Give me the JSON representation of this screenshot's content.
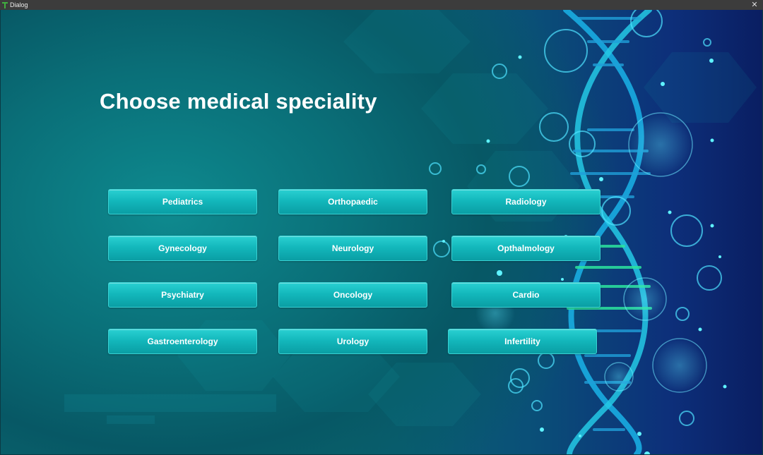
{
  "window": {
    "title": "Dialog",
    "close_glyph": "✕"
  },
  "heading": "Choose medical speciality",
  "specialities": [
    "Pediatrics",
    "Orthopaedic",
    "Radiology",
    "Gynecology",
    "Neurology",
    "Opthalmology",
    "Psychiatry",
    "Oncology",
    "Cardio",
    "Gastroenterology",
    "Urology",
    "Infertility"
  ],
  "colors": {
    "button": "#13b8bc",
    "heading": "#ffffff",
    "titlebar": "#3c3c3c"
  }
}
